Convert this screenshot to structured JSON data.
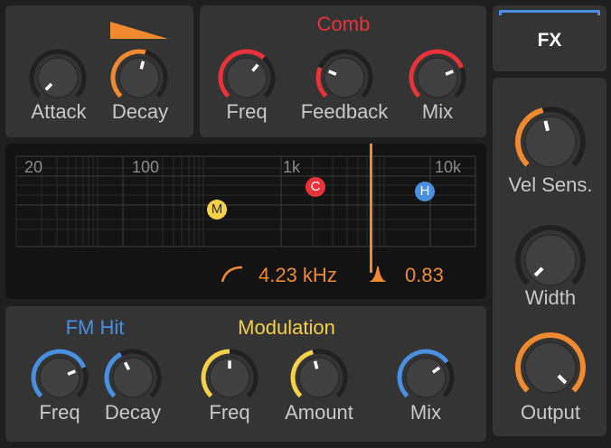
{
  "colors": {
    "orange": "#f08a30",
    "red": "#e8333b",
    "blue": "#4a8fe0",
    "yellow": "#f5d04a",
    "track": "#202020",
    "knob_body": "#404040"
  },
  "envelope": {
    "attack": {
      "label": "Attack",
      "value": 0.0,
      "ring": "none"
    },
    "decay": {
      "label": "Decay",
      "value": 0.55,
      "ring": "orange"
    },
    "shape_icon": "decay-ramp-icon"
  },
  "comb": {
    "title": "Comb",
    "freq": {
      "label": "Freq",
      "value": 0.65,
      "ring": "red"
    },
    "feedback": {
      "label": "Feedback",
      "value": 0.25,
      "ring": "red"
    },
    "mix": {
      "label": "Mix",
      "value": 0.75,
      "ring": "red"
    }
  },
  "spectrum": {
    "ticks": [
      "20",
      "100",
      "1k",
      "10k"
    ],
    "markers": {
      "m": "M",
      "c": "C",
      "h": "H"
    },
    "cutoff": "4.23 kHz",
    "resonance": "0.83",
    "cutoff_icon": "highpass-curve-icon",
    "resonance_icon": "peak-icon"
  },
  "fm_hit": {
    "title": "FM Hit",
    "freq": {
      "label": "Freq",
      "value": 0.75,
      "ring": "blue"
    },
    "decay": {
      "label": "Decay",
      "value": 0.4,
      "ring": "blue"
    }
  },
  "modulation": {
    "title": "Modulation",
    "freq": {
      "label": "Freq",
      "value": 0.5,
      "ring": "yellow"
    },
    "amount": {
      "label": "Amount",
      "value": 0.45,
      "ring": "yellow"
    },
    "mix": {
      "label": "Mix",
      "value": 0.7,
      "ring": "blue"
    }
  },
  "fx": {
    "label": "FX"
  },
  "output_section": {
    "vel_sens": {
      "label": "Vel Sens.",
      "value": 0.45,
      "ring": "orange"
    },
    "width": {
      "label": "Width",
      "value": 0.0,
      "ring": "none"
    },
    "output": {
      "label": "Output",
      "value": 1.0,
      "ring": "orange"
    }
  }
}
